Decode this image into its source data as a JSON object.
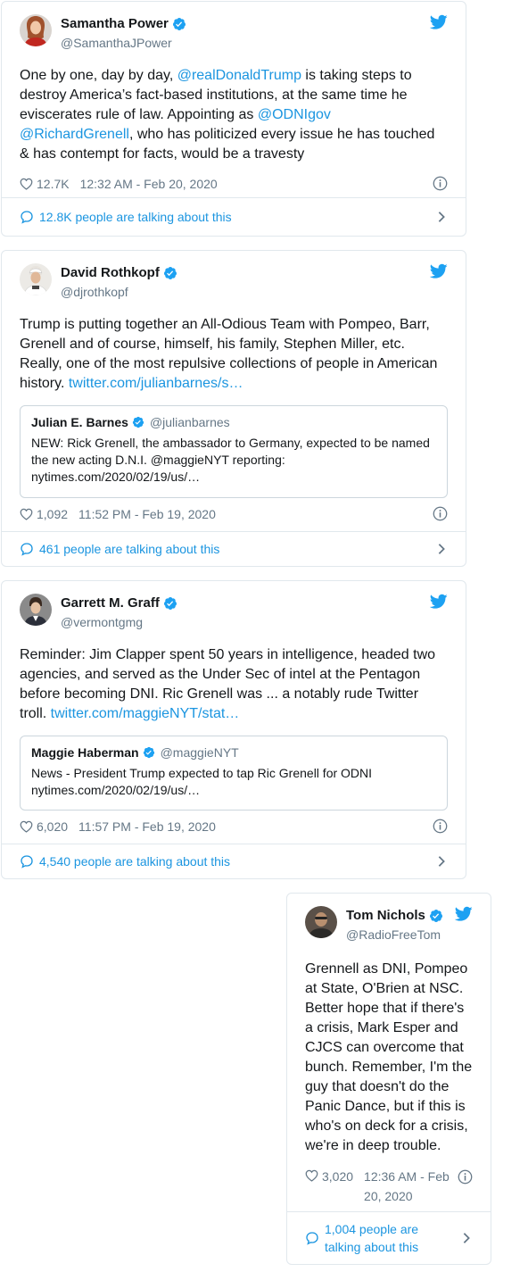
{
  "colors": {
    "link": "#1b95e0",
    "verified": "#1da1f2",
    "twitter": "#1da1f2",
    "secondary": "#657786"
  },
  "tweets": [
    {
      "name": "Samantha Power",
      "handle": "@SamanthaJPower",
      "text_parts": [
        "One by one, day by day, ",
        "@realDonaldTrump",
        " is taking steps to destroy America’s fact-based institutions, at the same time he eviscerates rule of law. Appointing as ",
        "@ODNIgov",
        " ",
        "@RichardGrenell",
        ", who has politicized every issue he has touched & has contempt for facts, would be a travesty"
      ],
      "likes": "12.7K",
      "time": "12:32 AM - Feb 20, 2020",
      "talking": "12.8K people are talking about this"
    },
    {
      "name": "David Rothkopf",
      "handle": "@djrothkopf",
      "text_parts": [
        "Trump is putting together an All-Odious Team with Pompeo, Barr, Grenell and of course, himself, his family, Stephen Miller, etc. Really, one of the most repulsive collections of people in American history. ",
        "twitter.com/julianbarnes/s…"
      ],
      "quote": {
        "name": "Julian E. Barnes",
        "handle": "@julianbarnes",
        "text": "NEW: Rick Grenell, the ambassador to Germany, expected to be named the new acting D.N.I. @maggieNYT reporting: nytimes.com/2020/02/19/us/…"
      },
      "likes": "1,092",
      "time": "11:52 PM - Feb 19, 2020",
      "talking": "461 people are talking about this"
    },
    {
      "name": "Garrett M. Graff",
      "handle": "@vermontgmg",
      "text_parts": [
        "Reminder: Jim Clapper spent 50 years in intelligence, headed two agencies, and served as the Under Sec of intel at the Pentagon before becoming DNI. Ric Grenell was ... a notably rude Twitter troll. ",
        "twitter.com/maggieNYT/stat…"
      ],
      "quote": {
        "name": "Maggie Haberman",
        "handle": "@maggieNYT",
        "text": "News - President Trump expected to tap Ric Grenell for ODNI nytimes.com/2020/02/19/us/…"
      },
      "likes": "6,020",
      "time": "11:57 PM - Feb 19, 2020",
      "talking": "4,540 people are talking about this"
    },
    {
      "name": "Tom Nichols",
      "handle": "@RadioFreeTom",
      "text": "Grennell as DNI, Pompeo at State, O'Brien at NSC. Better hope that if there's a crisis, Mark Esper and CJCS can overcome that bunch. Remember, I'm the guy that doesn't do the Panic Dance, but if this is who's on deck for a crisis, we're in deep trouble.",
      "likes": "3,020",
      "time": "12:36 AM - Feb 20, 2020",
      "talking": "1,004 people are talking about this"
    }
  ]
}
